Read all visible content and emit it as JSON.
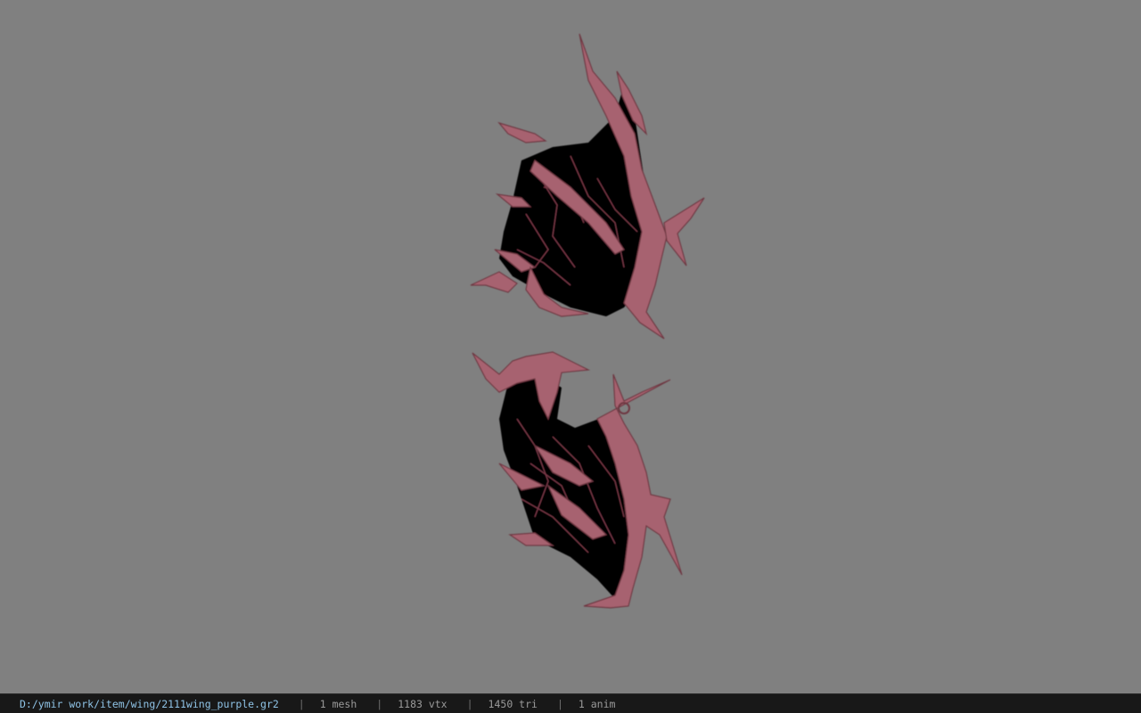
{
  "viewer": {
    "background_color": "#808080",
    "model_colors": {
      "bone": "#a7626f",
      "bone_dark": "#6e3842",
      "membrane": "#060304",
      "vein": "#7b3a48"
    }
  },
  "status_bar": {
    "file_path": "D:/ymir work/item/wing/2111wing_purple.gr2",
    "mesh_count": "1 mesh",
    "vertex_count": "1183 vtx",
    "triangle_count": "1450 tri",
    "anim_count": "1 anim",
    "separator": "|"
  }
}
